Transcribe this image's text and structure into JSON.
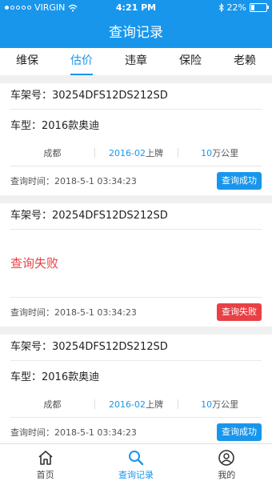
{
  "status": {
    "carrier": "VIRGIN",
    "time": "4:21 PM",
    "battery": "22%",
    "battery_level": 0.22
  },
  "header": {
    "title": "查询记录"
  },
  "tabs": [
    {
      "label": "维保"
    },
    {
      "label": "估价"
    },
    {
      "label": "违章"
    },
    {
      "label": "保险"
    },
    {
      "label": "老赖"
    }
  ],
  "records": [
    {
      "vin": "车架号：30254DFS12DS212SD",
      "model": "车型：2016款奥迪",
      "city": "成都",
      "reg_date": "2016-02",
      "reg_suffix": "上牌",
      "mileage": "10",
      "mileage_unit": "万公里",
      "query_time": "查询时间：2018-5-1 03:34:23",
      "status": "查询成功"
    },
    {
      "vin": "车架号：20254DFS12DS212SD",
      "fail_text": "查询失败",
      "query_time": "查询时间：2018-5-1 03:34:23",
      "status": "查询失败"
    },
    {
      "vin": "车架号：30254DFS12DS212SD",
      "model": "车型：2016款奥迪",
      "city": "成都",
      "reg_date": "2016-02",
      "reg_suffix": "上牌",
      "mileage": "10",
      "mileage_unit": "万公里",
      "query_time": "查询时间：2018-5-1 03:34:23",
      "status": "查询成功"
    }
  ],
  "bottom_nav": [
    {
      "label": "首页",
      "icon": "home-icon"
    },
    {
      "label": "查询记录",
      "icon": "search-icon"
    },
    {
      "label": "我的",
      "icon": "user-icon"
    }
  ],
  "colors": {
    "primary": "#1896ec",
    "danger": "#e84044"
  }
}
